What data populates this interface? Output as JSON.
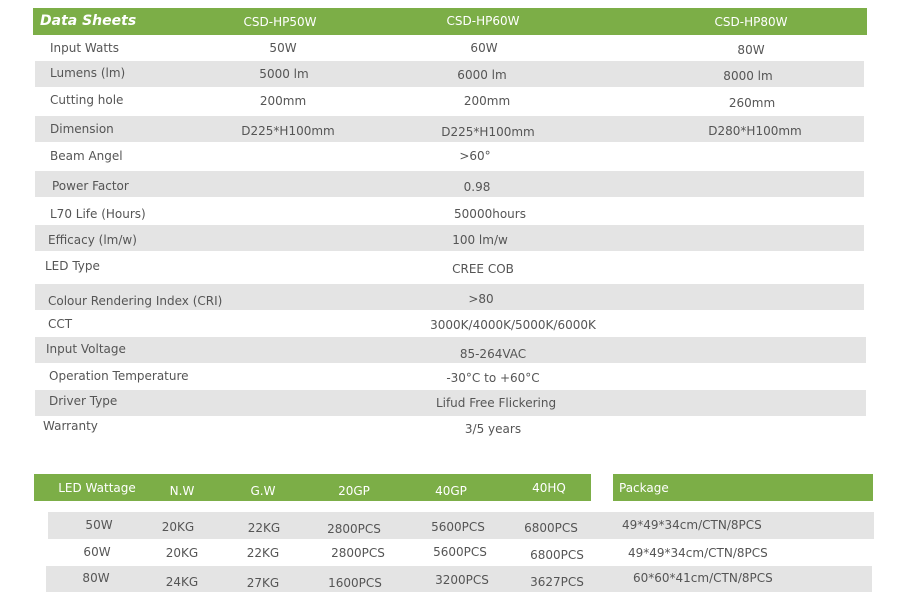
{
  "data_sheet": {
    "title": "Data Sheets",
    "models": [
      "CSD-HP50W",
      "CSD-HP60W",
      "CSD-HP80W"
    ],
    "rows": [
      {
        "label": "Input Watts",
        "values": [
          "50W",
          "60W",
          "80W"
        ]
      },
      {
        "label": "Lumens (lm)",
        "values": [
          "5000 lm",
          "6000 lm",
          "8000 lm"
        ]
      },
      {
        "label": "Cutting hole",
        "values": [
          "200mm",
          "200mm",
          "260mm"
        ]
      },
      {
        "label": "Dimension",
        "values": [
          "D225*H100mm",
          "D225*H100mm",
          "D280*H100mm"
        ]
      },
      {
        "label": "Beam Angel",
        "value": ">60°"
      },
      {
        "label": "Power Factor",
        "value": "0.98"
      },
      {
        "label": "L70 Life (Hours)",
        "value": "50000hours"
      },
      {
        "label": "Efficacy (lm/w)",
        "value": "100 lm/w"
      },
      {
        "label": "LED Type",
        "value": "CREE COB"
      },
      {
        "label": "Colour Rendering Index (CRI)",
        "value": ">80"
      },
      {
        "label": "CCT",
        "value": "3000K/4000K/5000K/6000K"
      },
      {
        "label": "Input Voltage",
        "value": "85-264VAC"
      },
      {
        "label": "Operation Temperature",
        "value": "-30°C to +60°C"
      },
      {
        "label": "Driver Type",
        "value": "Lifud Free Flickering"
      },
      {
        "label": "Warranty",
        "value": "3/5 years"
      }
    ]
  },
  "packing": {
    "headers": [
      "LED Wattage",
      "N.W",
      "G.W",
      "20GP",
      "40GP",
      "40HQ"
    ],
    "package_header": "Package",
    "rows": [
      {
        "cells": [
          "50W",
          "20KG",
          "22KG",
          "2800PCS",
          "5600PCS",
          "6800PCS"
        ],
        "package": "49*49*34cm/CTN/8PCS"
      },
      {
        "cells": [
          "60W",
          "20KG",
          "22KG",
          "2800PCS",
          "5600PCS",
          "6800PCS"
        ],
        "package": "49*49*34cm/CTN/8PCS"
      },
      {
        "cells": [
          "80W",
          "24KG",
          "27KG",
          "1600PCS",
          "3200PCS",
          "3627PCS"
        ],
        "package": "60*60*41cm/CTN/8PCS"
      }
    ]
  },
  "colors": {
    "header_green": "#7cae47",
    "stripe_grey": "#e4e4e4",
    "text": "#555555"
  }
}
